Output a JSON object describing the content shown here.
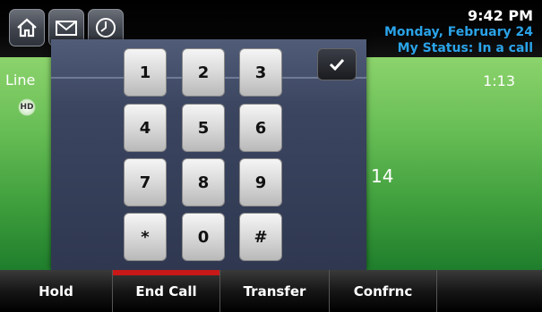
{
  "status_bar": {
    "home_icon": "home-icon",
    "messages_icon": "envelope-icon",
    "history_icon": "clock-icon",
    "time": "9:42 PM",
    "date": "Monday, February 24",
    "my_status": "My Status: In a call"
  },
  "call": {
    "line_label": "Line",
    "hd_label": "HD",
    "duration": "1:13",
    "number_partial": "14"
  },
  "dialpad": {
    "keys": [
      "1",
      "2",
      "3",
      "4",
      "5",
      "6",
      "7",
      "8",
      "9",
      "*",
      "0",
      "#"
    ],
    "ok_icon": "checkmark-icon"
  },
  "softkeys": [
    {
      "label": "Hold"
    },
    {
      "label": "End Call",
      "active": true
    },
    {
      "label": "Transfer"
    },
    {
      "label": "Confrnc"
    },
    {
      "label": ""
    }
  ],
  "colors": {
    "accent_blue": "#2aa3e8",
    "end_call_red": "#c81818",
    "call_green": "#67bd55"
  }
}
